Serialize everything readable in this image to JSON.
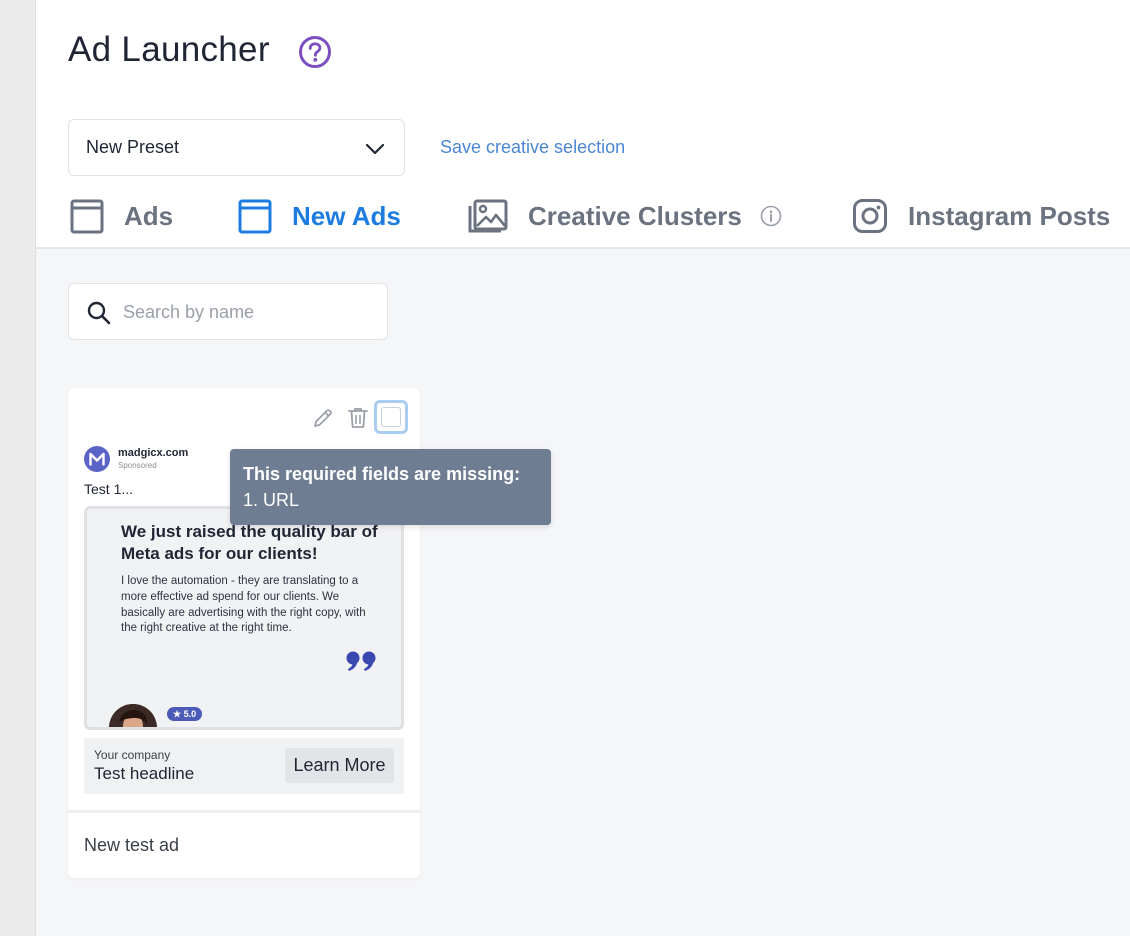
{
  "page": {
    "title": "Ad Launcher"
  },
  "preset": {
    "selected": "New Preset",
    "save_link": "Save creative selection"
  },
  "tabs": [
    {
      "label": "Ads",
      "icon": "square-icon",
      "active": false
    },
    {
      "label": "New Ads",
      "icon": "square-icon",
      "active": true
    },
    {
      "label": "Creative Clusters",
      "icon": "image-stack-icon",
      "active": false
    },
    {
      "label": "Instagram Posts",
      "icon": "instagram-icon",
      "active": false
    }
  ],
  "search": {
    "placeholder": "Search by name",
    "value": ""
  },
  "ad_card": {
    "brand_name": "madgicx.com",
    "sponsored": "Sponsored",
    "primary_text": "Test 1...",
    "creative": {
      "headline": "We just raised the quality bar of Meta ads for our clients!",
      "body": "I love the automation - they are translating to a more effective ad spend for our clients. We basically are advertising with the right copy, with the right creative at the right time.",
      "rating": "★ 5.0"
    },
    "cta": {
      "company": "Your company",
      "headline": "Test headline",
      "button": "Learn More"
    },
    "name": "New test ad"
  },
  "tooltip": {
    "title": "This required fields are missing:",
    "items": [
      "1. URL"
    ]
  },
  "colors": {
    "accent": "#1c7ce0",
    "help_purple": "#7b4fc0",
    "link": "#4a86d4",
    "tooltip_bg": "#6f7d93"
  }
}
